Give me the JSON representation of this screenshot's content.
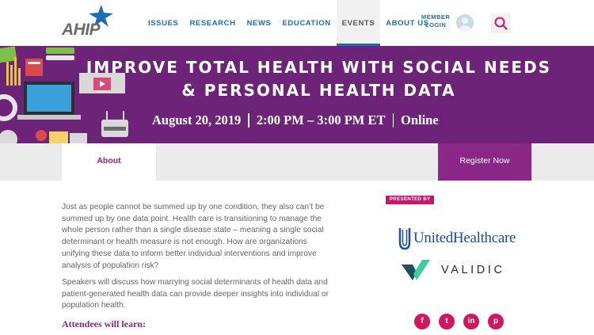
{
  "logo": {
    "text": "AHIP"
  },
  "nav": {
    "items": [
      {
        "label": "ISSUES"
      },
      {
        "label": "RESEARCH"
      },
      {
        "label": "NEWS"
      },
      {
        "label": "EDUCATION"
      },
      {
        "label": "EVENTS",
        "active": true
      },
      {
        "label": "ABOUT US"
      }
    ],
    "member_line1": "MEMBER",
    "member_line2": "LOGIN"
  },
  "icons": {
    "avatar": "user-avatar-icon",
    "search": "search-icon"
  },
  "hero": {
    "title_line1": "IMPROVE TOTAL HEALTH WITH SOCIAL NEEDS",
    "title_line2": "& PERSONAL HEALTH DATA",
    "date": "August 20, 2019",
    "time": "2:00 PM – 3:00 PM ET",
    "location": "Online"
  },
  "tabs": {
    "about": "About",
    "register": "Register Now"
  },
  "content": {
    "paragraph1": "Just as people cannot be summed up by one condition, they also can’t be summed up by one data point. Health care is transitioning to manage the whole person rather than a single disease state – meaning a single social determinant or health measure is not enough. How are organizations unifying these data to inform better individual interventions and improve analysis of population risk?",
    "paragraph2": "Speakers will discuss how marrying social determinants of health data and patient-generated health data can provide deeper insights into individual or population health.",
    "learn_heading": "Attendees will learn:"
  },
  "sponsors": {
    "badge": "PRESENTED BY",
    "sponsor1": "UnitedHealthcare",
    "sponsor2": "VALIDIC"
  },
  "social": [
    {
      "icon": "facebook-icon",
      "glyph": "f"
    },
    {
      "icon": "twitter-icon",
      "glyph": "t"
    },
    {
      "icon": "linkedin-icon",
      "glyph": "in"
    },
    {
      "icon": "pinterest-icon",
      "glyph": "p"
    }
  ],
  "colors": {
    "brand_blue": "#1a6fb0",
    "hero_purple": "#6d2478",
    "register_purple": "#8b2787",
    "accent_pink": "#c8166b"
  }
}
